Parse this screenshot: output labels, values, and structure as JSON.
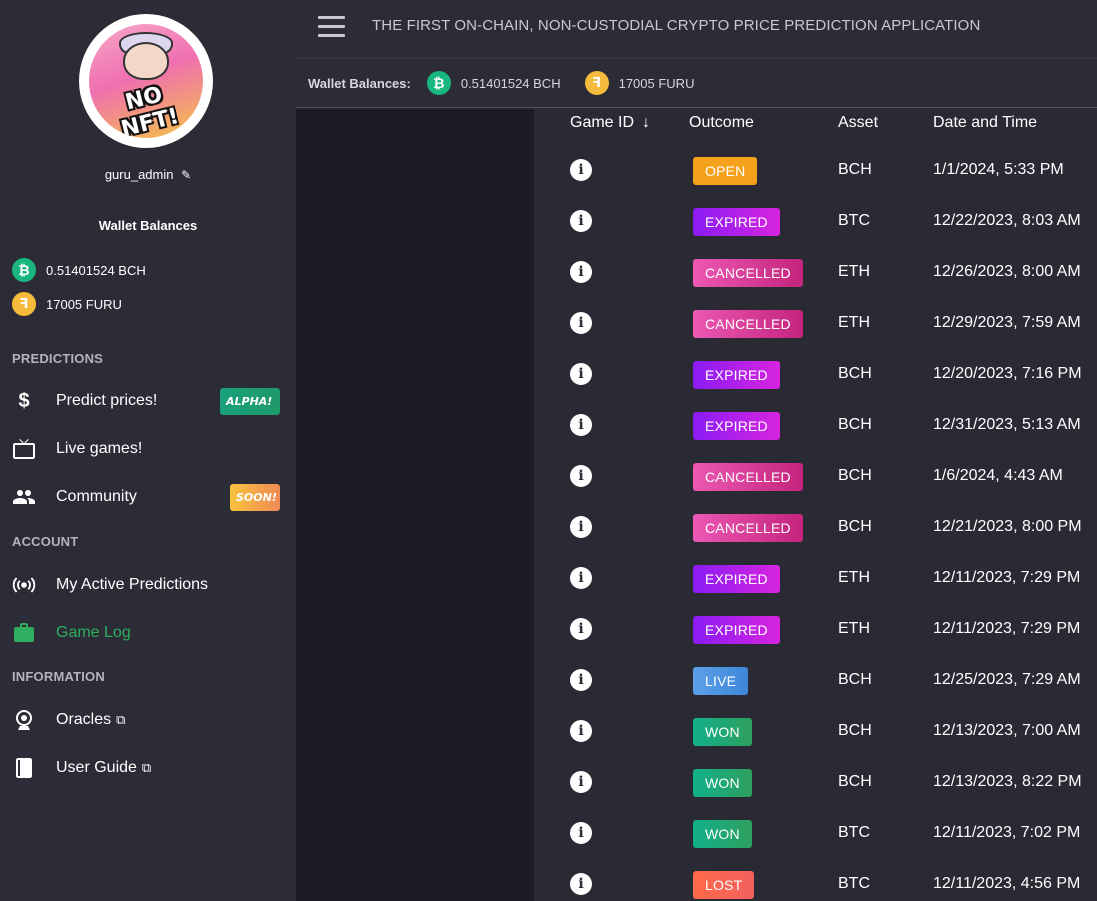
{
  "sidebar": {
    "avatar_text": "NO NFT!",
    "username": "guru_admin",
    "wallet_title": "Wallet Balances",
    "balances": [
      {
        "coin": "bch",
        "symbol": "₿",
        "text": "0.51401524 BCH"
      },
      {
        "coin": "furu",
        "symbol": "F",
        "text": "17005 FURU"
      }
    ],
    "sections": {
      "predictions": "PREDICTIONS",
      "account": "ACCOUNT",
      "information": "INFORMATION"
    },
    "items": [
      {
        "label": "Predict prices!",
        "icon": "dollar-icon",
        "badge": "ALPHA!"
      },
      {
        "label": "Live games!",
        "icon": "tv-icon"
      },
      {
        "label": "Community",
        "icon": "people-icon",
        "badge": "SOON!"
      },
      {
        "label": "My Active Predictions",
        "icon": "broadcast-icon"
      },
      {
        "label": "Game Log",
        "icon": "briefcase-icon",
        "active": true
      },
      {
        "label": "Oracles",
        "icon": "webcam-icon"
      },
      {
        "label": "User Guide",
        "icon": "book-icon"
      }
    ]
  },
  "header": {
    "title": "THE FIRST ON-CHAIN, NON-CUSTODIAL CRYPTO PRICE PREDICTION APPLICATION"
  },
  "walletbar": {
    "title": "Wallet Balances:",
    "bch": "0.51401524 BCH",
    "furu": "17005 FURU"
  },
  "table": {
    "columns": [
      "Game ID",
      "Outcome",
      "Asset",
      "Date and Time"
    ],
    "rows": [
      {
        "outcome": "OPEN",
        "asset": "BCH",
        "date": "1/1/2024, 5:33 PM"
      },
      {
        "outcome": "EXPIRED",
        "asset": "BTC",
        "date": "12/22/2023, 8:03 AM"
      },
      {
        "outcome": "CANCELLED",
        "asset": "ETH",
        "date": "12/26/2023, 8:00 AM"
      },
      {
        "outcome": "CANCELLED",
        "asset": "ETH",
        "date": "12/29/2023, 7:59 AM"
      },
      {
        "outcome": "EXPIRED",
        "asset": "BCH",
        "date": "12/20/2023, 7:16 PM"
      },
      {
        "outcome": "EXPIRED",
        "asset": "BCH",
        "date": "12/31/2023, 5:13 AM"
      },
      {
        "outcome": "CANCELLED",
        "asset": "BCH",
        "date": "1/6/2024, 4:43 AM"
      },
      {
        "outcome": "CANCELLED",
        "asset": "BCH",
        "date": "12/21/2023, 8:00 PM"
      },
      {
        "outcome": "EXPIRED",
        "asset": "ETH",
        "date": "12/11/2023, 7:29 PM"
      },
      {
        "outcome": "EXPIRED",
        "asset": "ETH",
        "date": "12/11/2023, 7:29 PM"
      },
      {
        "outcome": "LIVE",
        "asset": "BCH",
        "date": "12/25/2023, 7:29 AM"
      },
      {
        "outcome": "WON",
        "asset": "BCH",
        "date": "12/13/2023, 7:00 AM"
      },
      {
        "outcome": "WON",
        "asset": "BCH",
        "date": "12/13/2023, 8:22 PM"
      },
      {
        "outcome": "WON",
        "asset": "BTC",
        "date": "12/11/2023, 7:02 PM"
      },
      {
        "outcome": "LOST",
        "asset": "BTC",
        "date": "12/11/2023, 4:56 PM"
      }
    ]
  },
  "colors": {
    "sidebar_bg": "#2b2c36",
    "active_green": "#2fae5f",
    "open": "#f4a21b",
    "expired": "#b020ea",
    "cancelled": "#d8409a",
    "live": "#4a93e0",
    "won": "#1fa874",
    "lost": "#f8644f"
  }
}
